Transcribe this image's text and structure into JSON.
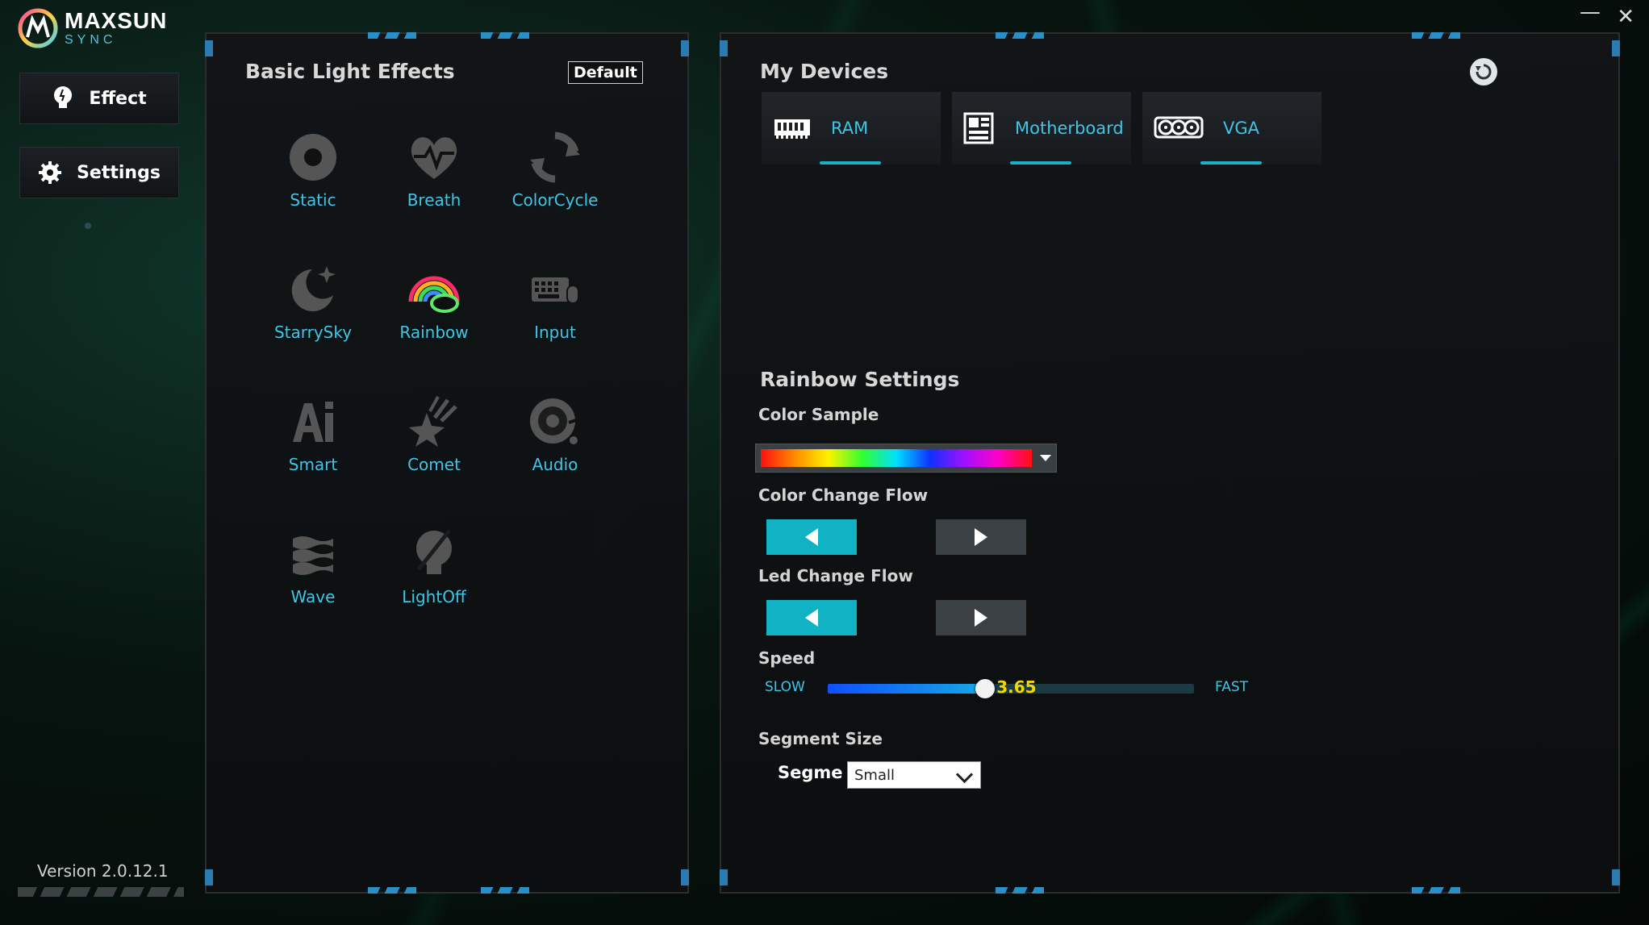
{
  "app": {
    "brand": "MAXSUN",
    "brand_sub": "SYNC",
    "version": "Version 2.0.12.1"
  },
  "window": {
    "minimize": "—",
    "close": "✕"
  },
  "nav": {
    "effect": "Effect",
    "settings": "Settings"
  },
  "effects_panel": {
    "title": "Basic Light Effects",
    "default_label": "Default",
    "items": [
      {
        "label": "Static",
        "icon": "static-icon"
      },
      {
        "label": "Breath",
        "icon": "heart-pulse-icon"
      },
      {
        "label": "ColorCycle",
        "icon": "cycle-icon"
      },
      {
        "label": "StarrySky",
        "icon": "moon-star-icon"
      },
      {
        "label": "Rainbow",
        "icon": "rainbow-icon"
      },
      {
        "label": "Input",
        "icon": "keyboard-icon"
      },
      {
        "label": "Smart",
        "icon": "ai-icon"
      },
      {
        "label": "Comet",
        "icon": "comet-icon"
      },
      {
        "label": "Audio",
        "icon": "audio-icon"
      },
      {
        "label": "Wave",
        "icon": "wave-icon"
      },
      {
        "label": "LightOff",
        "icon": "light-off-icon"
      }
    ]
  },
  "devices_panel": {
    "title": "My Devices",
    "devices": [
      {
        "label": "RAM",
        "icon": "ram-icon"
      },
      {
        "label": "Motherboard",
        "icon": "motherboard-icon"
      },
      {
        "label": "VGA",
        "icon": "vga-icon"
      }
    ]
  },
  "rainbow_settings": {
    "title": "Rainbow Settings",
    "color_sample_label": "Color Sample",
    "color_change_flow_label": "Color Change Flow",
    "led_change_flow_label": "Led Change Flow",
    "speed_label": "Speed",
    "speed_slow": "SLOW",
    "speed_fast": "FAST",
    "speed_value": "3.65",
    "speed_fraction": 0.43,
    "segment_size_label": "Segment Size",
    "segment_field_label": "Segme",
    "segment_value": "Small"
  },
  "colors": {
    "accent": "#3fc5e6",
    "active_button": "#11b2c4",
    "speed_value": "#f2d800"
  }
}
